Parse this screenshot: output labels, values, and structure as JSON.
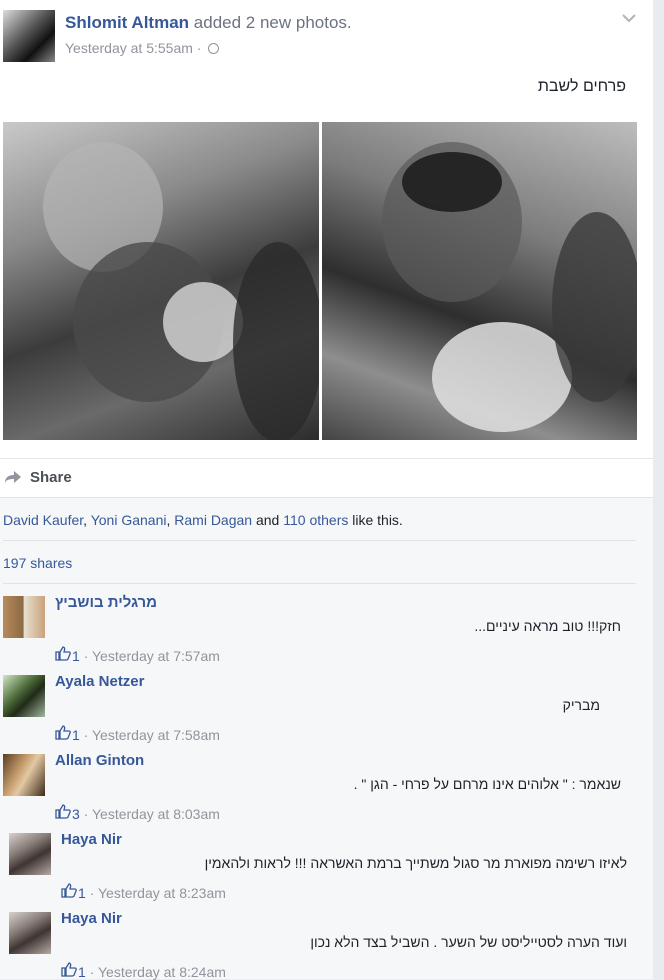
{
  "post": {
    "author": "Shlomit Altman",
    "action": "added 2 new photos.",
    "time": "Yesterday at 5:55am",
    "time_sep": "·",
    "caption": "פרחים לשבת",
    "share_label": "Share"
  },
  "likes": {
    "people": [
      "David Kaufer",
      "Yoni Ganani",
      "Rami Dagan"
    ],
    "sep1": ", ",
    "sep2": ", ",
    "and": " and ",
    "others": "110 others",
    "suffix": " like this."
  },
  "shares": "197 shares",
  "comments": [
    {
      "name": "מרגלית בושביץ",
      "text": "חזק!!! טוב מראה עיניים...",
      "likes": "1",
      "time": "Yesterday at 7:57am"
    },
    {
      "name": "Ayala Netzer",
      "text": "מבריק",
      "likes": "1",
      "time": "Yesterday at 7:58am"
    },
    {
      "name": "Allan Ginton",
      "text": "שנאמר : \" אלוהים אינו מרחם על פרחי - הגן \" .",
      "likes": "3",
      "time": "Yesterday at 8:03am"
    },
    {
      "name": "Haya Nir",
      "text": "לאיזו רשימה מפוארת מר סגול משתייך ברמת האשראה !!! לראות ולהאמין",
      "likes": "1",
      "time": "Yesterday at 8:23am"
    },
    {
      "name": "Haya Nir",
      "text": "ועוד הערה לסטייליסט של השער . השביל בצד הלא נכון",
      "likes": "1",
      "time": "Yesterday at 8:24am"
    }
  ],
  "meta_sep": " · ",
  "icons": {
    "like": "thumbs-up-icon",
    "share": "share-arrow-icon",
    "globe": "globe-icon",
    "chevron": "chevron-down-icon"
  }
}
